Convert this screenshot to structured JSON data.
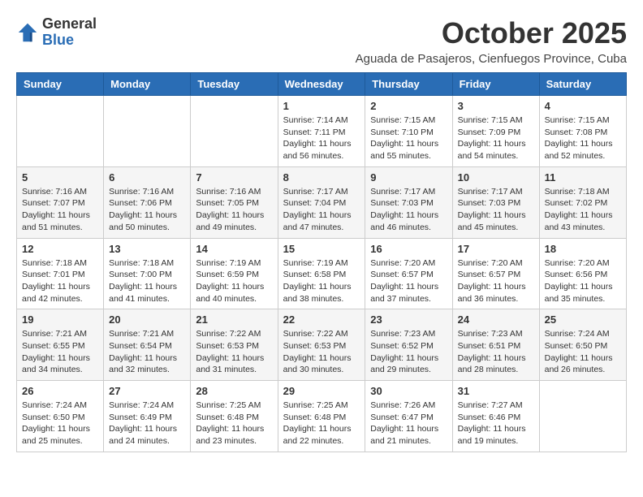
{
  "header": {
    "logo_general": "General",
    "logo_blue": "Blue",
    "month_title": "October 2025",
    "location": "Aguada de Pasajeros, Cienfuegos Province, Cuba"
  },
  "days_of_week": [
    "Sunday",
    "Monday",
    "Tuesday",
    "Wednesday",
    "Thursday",
    "Friday",
    "Saturday"
  ],
  "weeks": [
    [
      {
        "day": "",
        "info": ""
      },
      {
        "day": "",
        "info": ""
      },
      {
        "day": "",
        "info": ""
      },
      {
        "day": "1",
        "info": "Sunrise: 7:14 AM\nSunset: 7:11 PM\nDaylight: 11 hours and 56 minutes."
      },
      {
        "day": "2",
        "info": "Sunrise: 7:15 AM\nSunset: 7:10 PM\nDaylight: 11 hours and 55 minutes."
      },
      {
        "day": "3",
        "info": "Sunrise: 7:15 AM\nSunset: 7:09 PM\nDaylight: 11 hours and 54 minutes."
      },
      {
        "day": "4",
        "info": "Sunrise: 7:15 AM\nSunset: 7:08 PM\nDaylight: 11 hours and 52 minutes."
      }
    ],
    [
      {
        "day": "5",
        "info": "Sunrise: 7:16 AM\nSunset: 7:07 PM\nDaylight: 11 hours and 51 minutes."
      },
      {
        "day": "6",
        "info": "Sunrise: 7:16 AM\nSunset: 7:06 PM\nDaylight: 11 hours and 50 minutes."
      },
      {
        "day": "7",
        "info": "Sunrise: 7:16 AM\nSunset: 7:05 PM\nDaylight: 11 hours and 49 minutes."
      },
      {
        "day": "8",
        "info": "Sunrise: 7:17 AM\nSunset: 7:04 PM\nDaylight: 11 hours and 47 minutes."
      },
      {
        "day": "9",
        "info": "Sunrise: 7:17 AM\nSunset: 7:03 PM\nDaylight: 11 hours and 46 minutes."
      },
      {
        "day": "10",
        "info": "Sunrise: 7:17 AM\nSunset: 7:03 PM\nDaylight: 11 hours and 45 minutes."
      },
      {
        "day": "11",
        "info": "Sunrise: 7:18 AM\nSunset: 7:02 PM\nDaylight: 11 hours and 43 minutes."
      }
    ],
    [
      {
        "day": "12",
        "info": "Sunrise: 7:18 AM\nSunset: 7:01 PM\nDaylight: 11 hours and 42 minutes."
      },
      {
        "day": "13",
        "info": "Sunrise: 7:18 AM\nSunset: 7:00 PM\nDaylight: 11 hours and 41 minutes."
      },
      {
        "day": "14",
        "info": "Sunrise: 7:19 AM\nSunset: 6:59 PM\nDaylight: 11 hours and 40 minutes."
      },
      {
        "day": "15",
        "info": "Sunrise: 7:19 AM\nSunset: 6:58 PM\nDaylight: 11 hours and 38 minutes."
      },
      {
        "day": "16",
        "info": "Sunrise: 7:20 AM\nSunset: 6:57 PM\nDaylight: 11 hours and 37 minutes."
      },
      {
        "day": "17",
        "info": "Sunrise: 7:20 AM\nSunset: 6:57 PM\nDaylight: 11 hours and 36 minutes."
      },
      {
        "day": "18",
        "info": "Sunrise: 7:20 AM\nSunset: 6:56 PM\nDaylight: 11 hours and 35 minutes."
      }
    ],
    [
      {
        "day": "19",
        "info": "Sunrise: 7:21 AM\nSunset: 6:55 PM\nDaylight: 11 hours and 34 minutes."
      },
      {
        "day": "20",
        "info": "Sunrise: 7:21 AM\nSunset: 6:54 PM\nDaylight: 11 hours and 32 minutes."
      },
      {
        "day": "21",
        "info": "Sunrise: 7:22 AM\nSunset: 6:53 PM\nDaylight: 11 hours and 31 minutes."
      },
      {
        "day": "22",
        "info": "Sunrise: 7:22 AM\nSunset: 6:53 PM\nDaylight: 11 hours and 30 minutes."
      },
      {
        "day": "23",
        "info": "Sunrise: 7:23 AM\nSunset: 6:52 PM\nDaylight: 11 hours and 29 minutes."
      },
      {
        "day": "24",
        "info": "Sunrise: 7:23 AM\nSunset: 6:51 PM\nDaylight: 11 hours and 28 minutes."
      },
      {
        "day": "25",
        "info": "Sunrise: 7:24 AM\nSunset: 6:50 PM\nDaylight: 11 hours and 26 minutes."
      }
    ],
    [
      {
        "day": "26",
        "info": "Sunrise: 7:24 AM\nSunset: 6:50 PM\nDaylight: 11 hours and 25 minutes."
      },
      {
        "day": "27",
        "info": "Sunrise: 7:24 AM\nSunset: 6:49 PM\nDaylight: 11 hours and 24 minutes."
      },
      {
        "day": "28",
        "info": "Sunrise: 7:25 AM\nSunset: 6:48 PM\nDaylight: 11 hours and 23 minutes."
      },
      {
        "day": "29",
        "info": "Sunrise: 7:25 AM\nSunset: 6:48 PM\nDaylight: 11 hours and 22 minutes."
      },
      {
        "day": "30",
        "info": "Sunrise: 7:26 AM\nSunset: 6:47 PM\nDaylight: 11 hours and 21 minutes."
      },
      {
        "day": "31",
        "info": "Sunrise: 7:27 AM\nSunset: 6:46 PM\nDaylight: 11 hours and 19 minutes."
      },
      {
        "day": "",
        "info": ""
      }
    ]
  ]
}
